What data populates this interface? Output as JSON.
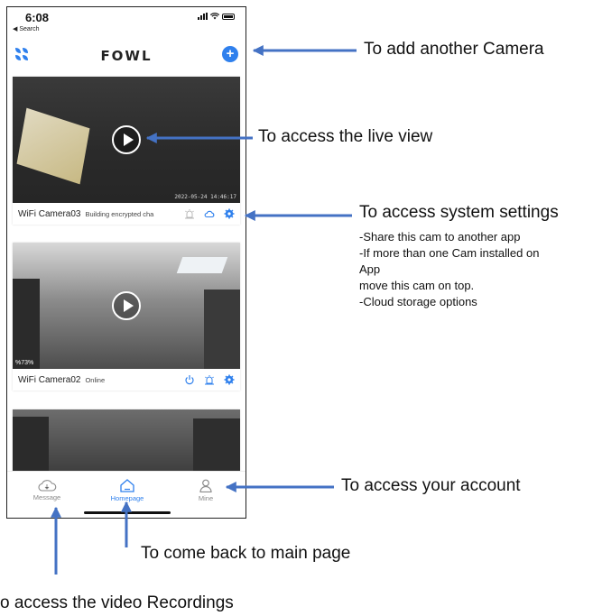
{
  "status_bar": {
    "time": "6:08",
    "back_label": "◀ Search"
  },
  "app": {
    "logo_text": "FOWL",
    "add_camera_icon": "plus-circle-icon",
    "menu_icon": "grid-menu-icon",
    "accent_color": "#2f80ed"
  },
  "cameras": [
    {
      "name": "WiFi Camera03",
      "status": "Building encrypted cha",
      "timestamp": "2022-05-24 14:46:17",
      "icons": [
        "alarm-icon",
        "cloud-icon",
        "gear-icon"
      ]
    },
    {
      "name": "WiFi Camera02",
      "status": "Online",
      "signal": "%73%",
      "icons": [
        "power-icon",
        "alarm-icon",
        "gear-icon"
      ]
    }
  ],
  "tabs": [
    {
      "label": "Message",
      "icon": "cloud-message-icon",
      "active": false
    },
    {
      "label": "Homepage",
      "icon": "home-icon",
      "active": true
    },
    {
      "label": "Mine",
      "icon": "user-icon",
      "active": false
    }
  ],
  "annotations": {
    "add_camera": "To add another Camera",
    "live_view": "To access the live view",
    "system_settings": "To access system settings",
    "settings_notes": [
      "-Share this cam to another app",
      "-If more than one Cam installed on",
      "App",
      "move this cam on top.",
      "-Cloud storage options"
    ],
    "account": "To access your account",
    "main_page": "To come back to main page",
    "recordings": "o access the video Recordings"
  }
}
